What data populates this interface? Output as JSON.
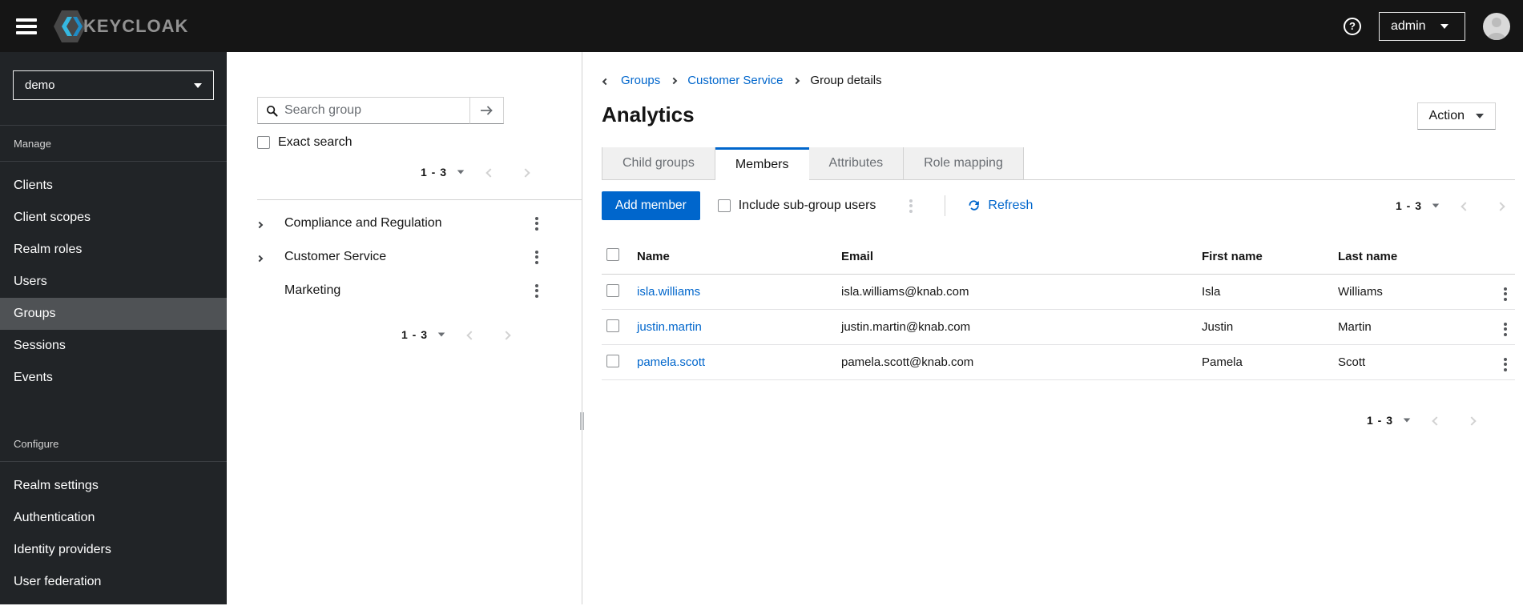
{
  "colors": {
    "accent": "#0066cc",
    "header_bg": "#151515",
    "sidebar_bg": "#212427",
    "sidebar_active_bg": "#4f5255",
    "link": "#0066cc",
    "muted_text": "#6a6e73",
    "border": "#d2d2d2"
  },
  "header": {
    "brand_text": "KEYCLOAK",
    "help_glyph": "?",
    "username": "admin"
  },
  "sidebar": {
    "realm": "demo",
    "sections": [
      {
        "label": "Manage",
        "items": [
          {
            "label": "Clients"
          },
          {
            "label": "Client scopes"
          },
          {
            "label": "Realm roles"
          },
          {
            "label": "Users"
          },
          {
            "label": "Groups",
            "active": true
          },
          {
            "label": "Sessions"
          },
          {
            "label": "Events"
          }
        ]
      },
      {
        "label": "Configure",
        "items": [
          {
            "label": "Realm settings"
          },
          {
            "label": "Authentication"
          },
          {
            "label": "Identity providers"
          },
          {
            "label": "User federation"
          }
        ]
      }
    ]
  },
  "group_panel": {
    "search_placeholder": "Search group",
    "exact_search_label": "Exact search",
    "pagination_top": {
      "range": "1 - 3"
    },
    "pagination_bottom": {
      "range": "1 - 3"
    },
    "groups": [
      {
        "name": "Compliance and Regulation",
        "expandable": true
      },
      {
        "name": "Customer Service",
        "expandable": true
      },
      {
        "name": "Marketing",
        "expandable": false
      }
    ]
  },
  "main": {
    "breadcrumb": [
      "Groups",
      "Customer Service",
      "Group details"
    ],
    "title": "Analytics",
    "action_label": "Action",
    "tabs": [
      {
        "label": "Child groups"
      },
      {
        "label": "Members",
        "active": true
      },
      {
        "label": "Attributes"
      },
      {
        "label": "Role mapping"
      }
    ],
    "toolbar": {
      "add_member_label": "Add member",
      "include_subgroup_label": "Include sub-group users",
      "refresh_label": "Refresh",
      "pagination": {
        "range": "1 - 3"
      }
    },
    "table": {
      "headers": [
        "Name",
        "Email",
        "First name",
        "Last name"
      ],
      "rows": [
        {
          "username": "isla.williams",
          "email": "isla.williams@knab.com",
          "first_name": "Isla",
          "last_name": "Williams"
        },
        {
          "username": "justin.martin",
          "email": "justin.martin@knab.com",
          "first_name": "Justin",
          "last_name": "Martin"
        },
        {
          "username": "pamela.scott",
          "email": "pamela.scott@knab.com",
          "first_name": "Pamela",
          "last_name": "Scott"
        }
      ]
    },
    "pagination_bottom": {
      "range": "1 - 3"
    }
  }
}
